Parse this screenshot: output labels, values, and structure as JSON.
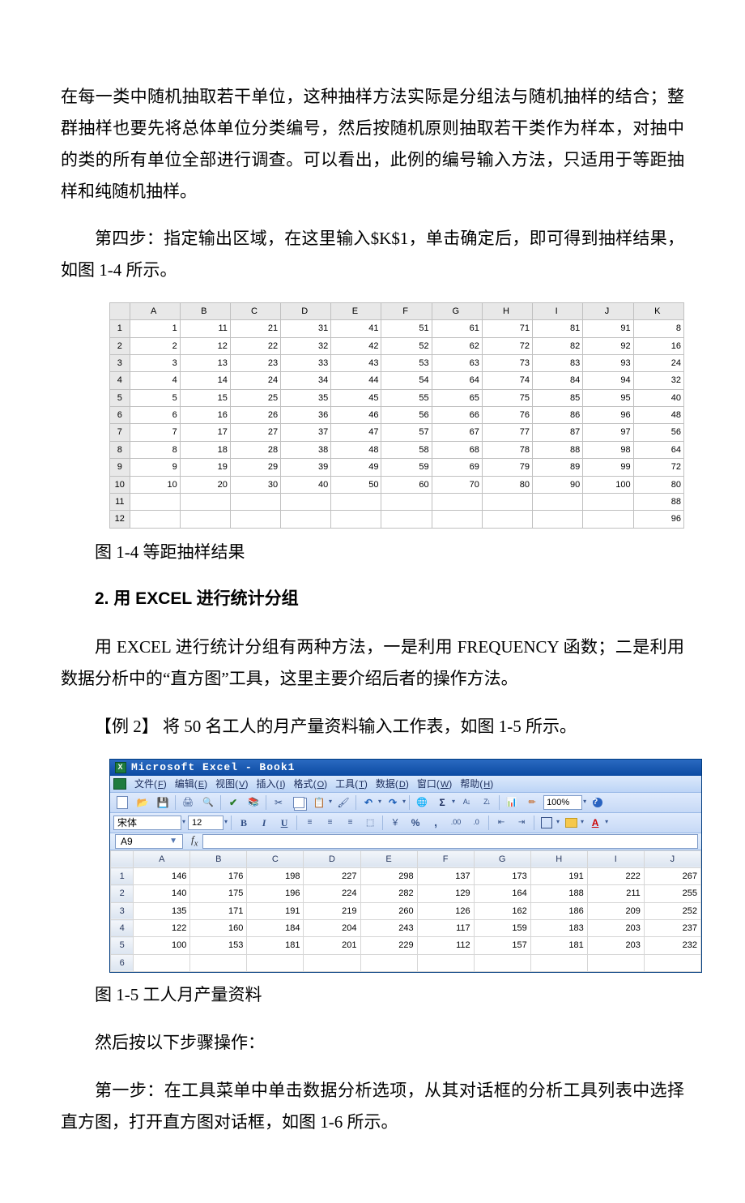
{
  "para1": "在每一类中随机抽取若干单位，这种抽样方法实际是分组法与随机抽样的结合；整群抽样也要先将总体单位分类编号，然后按随机原则抽取若干类作为样本，对抽中的类的所有单位全部进行调查。可以看出，此例的编号输入方法，只适用于等距抽样和纯随机抽样。",
  "para2": "第四步：指定输出区域，在这里输入$K$1，单击确定后，即可得到抽样结果，如图 1-4 所示。",
  "fig1": {
    "cols": [
      "A",
      "B",
      "C",
      "D",
      "E",
      "F",
      "G",
      "H",
      "I",
      "J",
      "K"
    ],
    "rows": [
      [
        "1",
        "1",
        "11",
        "21",
        "31",
        "41",
        "51",
        "61",
        "71",
        "81",
        "91",
        "8"
      ],
      [
        "2",
        "2",
        "12",
        "22",
        "32",
        "42",
        "52",
        "62",
        "72",
        "82",
        "92",
        "16"
      ],
      [
        "3",
        "3",
        "13",
        "23",
        "33",
        "43",
        "53",
        "63",
        "73",
        "83",
        "93",
        "24"
      ],
      [
        "4",
        "4",
        "14",
        "24",
        "34",
        "44",
        "54",
        "64",
        "74",
        "84",
        "94",
        "32"
      ],
      [
        "5",
        "5",
        "15",
        "25",
        "35",
        "45",
        "55",
        "65",
        "75",
        "85",
        "95",
        "40"
      ],
      [
        "6",
        "6",
        "16",
        "26",
        "36",
        "46",
        "56",
        "66",
        "76",
        "86",
        "96",
        "48"
      ],
      [
        "7",
        "7",
        "17",
        "27",
        "37",
        "47",
        "57",
        "67",
        "77",
        "87",
        "97",
        "56"
      ],
      [
        "8",
        "8",
        "18",
        "28",
        "38",
        "48",
        "58",
        "68",
        "78",
        "88",
        "98",
        "64"
      ],
      [
        "9",
        "9",
        "19",
        "29",
        "39",
        "49",
        "59",
        "69",
        "79",
        "89",
        "99",
        "72"
      ],
      [
        "10",
        "10",
        "20",
        "30",
        "40",
        "50",
        "60",
        "70",
        "80",
        "90",
        "100",
        "80"
      ],
      [
        "11",
        "",
        "",
        "",
        "",
        "",
        "",
        "",
        "",
        "",
        "",
        "88"
      ],
      [
        "12",
        "",
        "",
        "",
        "",
        "",
        "",
        "",
        "",
        "",
        "",
        "96"
      ]
    ]
  },
  "caption1": "图 1-4 等距抽样结果",
  "heading2": "2. 用 EXCEL 进行统计分组",
  "para3": "用 EXCEL 进行统计分组有两种方法，一是利用 FREQUENCY 函数；二是利用数据分析中的“直方图”工具，这里主要介绍后者的操作方法。",
  "para4": "【例 2】 将 50 名工人的月产量资料输入工作表，如图 1-5 所示。",
  "excel": {
    "title": "Microsoft Excel - Book1",
    "menus": [
      {
        "zh": "文件",
        "m": "F"
      },
      {
        "zh": "编辑",
        "m": "E"
      },
      {
        "zh": "视图",
        "m": "V"
      },
      {
        "zh": "插入",
        "m": "I"
      },
      {
        "zh": "格式",
        "m": "O"
      },
      {
        "zh": "工具",
        "m": "T"
      },
      {
        "zh": "数据",
        "m": "D"
      },
      {
        "zh": "窗口",
        "m": "W"
      },
      {
        "zh": "帮助",
        "m": "H"
      }
    ],
    "font_name": "宋体",
    "font_size": "12",
    "zoom": "100%",
    "namebox": "A9",
    "cols": [
      "A",
      "B",
      "C",
      "D",
      "E",
      "F",
      "G",
      "H",
      "I",
      "J"
    ],
    "rows": [
      [
        "1",
        "146",
        "176",
        "198",
        "227",
        "298",
        "137",
        "173",
        "191",
        "222",
        "267"
      ],
      [
        "2",
        "140",
        "175",
        "196",
        "224",
        "282",
        "129",
        "164",
        "188",
        "211",
        "255"
      ],
      [
        "3",
        "135",
        "171",
        "191",
        "219",
        "260",
        "126",
        "162",
        "186",
        "209",
        "252"
      ],
      [
        "4",
        "122",
        "160",
        "184",
        "204",
        "243",
        "117",
        "159",
        "183",
        "203",
        "237"
      ],
      [
        "5",
        "100",
        "153",
        "181",
        "201",
        "229",
        "112",
        "157",
        "181",
        "203",
        "232"
      ],
      [
        "6",
        "",
        "",
        "",
        "",
        "",
        "",
        "",
        "",
        "",
        ""
      ]
    ]
  },
  "caption2": "图 1-5 工人月产量资料",
  "para5": "然后按以下步骤操作：",
  "para6": "第一步：在工具菜单中单击数据分析选项，从其对话框的分析工具列表中选择直方图，打开直方图对话框，如图 1-6 所示。",
  "icon_names": {
    "bold": "B",
    "italic": "I",
    "under": "U",
    "al_l": "≡",
    "al_c": "≡",
    "al_r": "≡",
    "al_m": "⧉",
    "inc": ".00→.0",
    "dec": ".0→.00",
    "ind_dec": "⇤",
    "ind_inc": "⇥"
  }
}
